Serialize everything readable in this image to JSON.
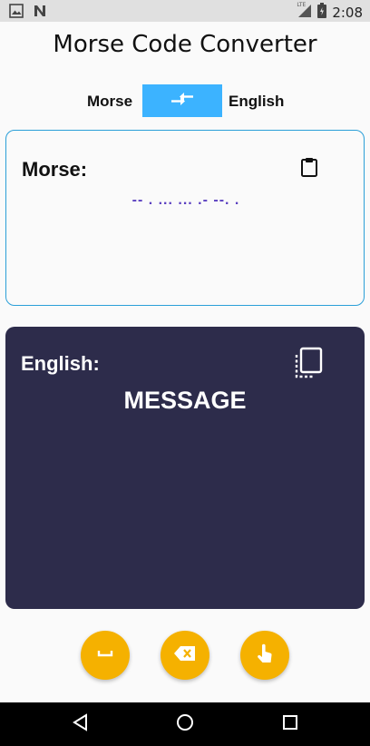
{
  "status_bar": {
    "time": "2:08",
    "network_label": "LTE",
    "icons": [
      "image-icon",
      "n-icon",
      "signal-icon",
      "battery-icon"
    ]
  },
  "header": {
    "title": "Morse Code Converter"
  },
  "switcher": {
    "left_label": "Morse",
    "right_label": "English",
    "swap_icon": "swap-arrows-icon",
    "accent_color": "#3cb3ff"
  },
  "morse_panel": {
    "label": "Morse:",
    "value": "-- . ... ... .- --. .",
    "paste_icon": "clipboard-icon",
    "border_color": "#2a9fd8",
    "text_color": "#5a3fc0"
  },
  "english_panel": {
    "label": "English:",
    "value": "MESSAGE",
    "copy_icon": "copy-icon",
    "background_color": "#2d2c4b"
  },
  "actions": [
    {
      "name": "space",
      "icon": "space-bar-icon"
    },
    {
      "name": "backspace",
      "icon": "backspace-icon"
    },
    {
      "name": "tap",
      "icon": "touch-icon"
    }
  ],
  "action_color": "#f5b100",
  "nav_bar": {
    "icons": [
      "nav-back-icon",
      "nav-home-icon",
      "nav-recents-icon"
    ]
  }
}
